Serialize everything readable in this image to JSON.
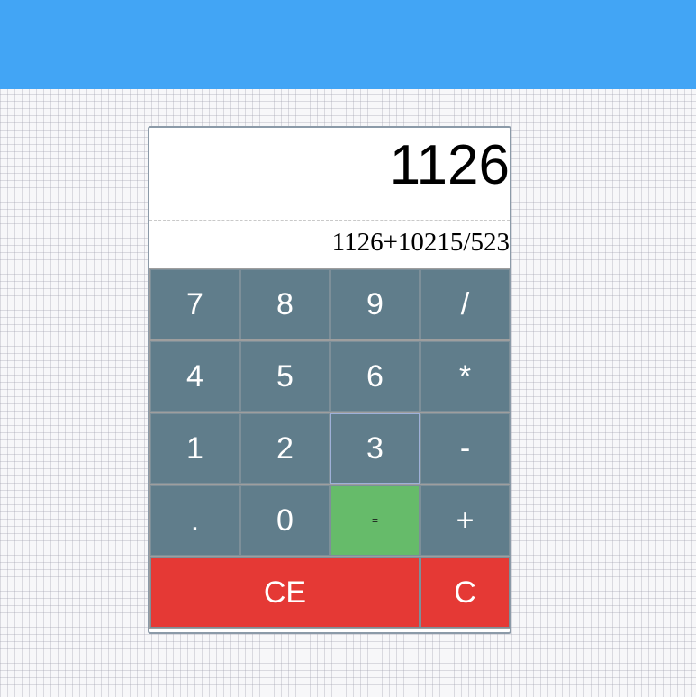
{
  "display": {
    "result": "1126",
    "expression": "1126+10215/523"
  },
  "keypad": {
    "rows": [
      [
        "7",
        "8",
        "9",
        "/"
      ],
      [
        "4",
        "5",
        "6",
        "*"
      ],
      [
        "1",
        "2",
        "3",
        "-"
      ],
      [
        ".",
        "0",
        "=",
        "+"
      ]
    ],
    "clear_entry": "CE",
    "clear": "C"
  },
  "colors": {
    "header": "#42a5f5",
    "key": "#607d8b",
    "equals": "#66bb6a",
    "clear": "#e53935"
  }
}
